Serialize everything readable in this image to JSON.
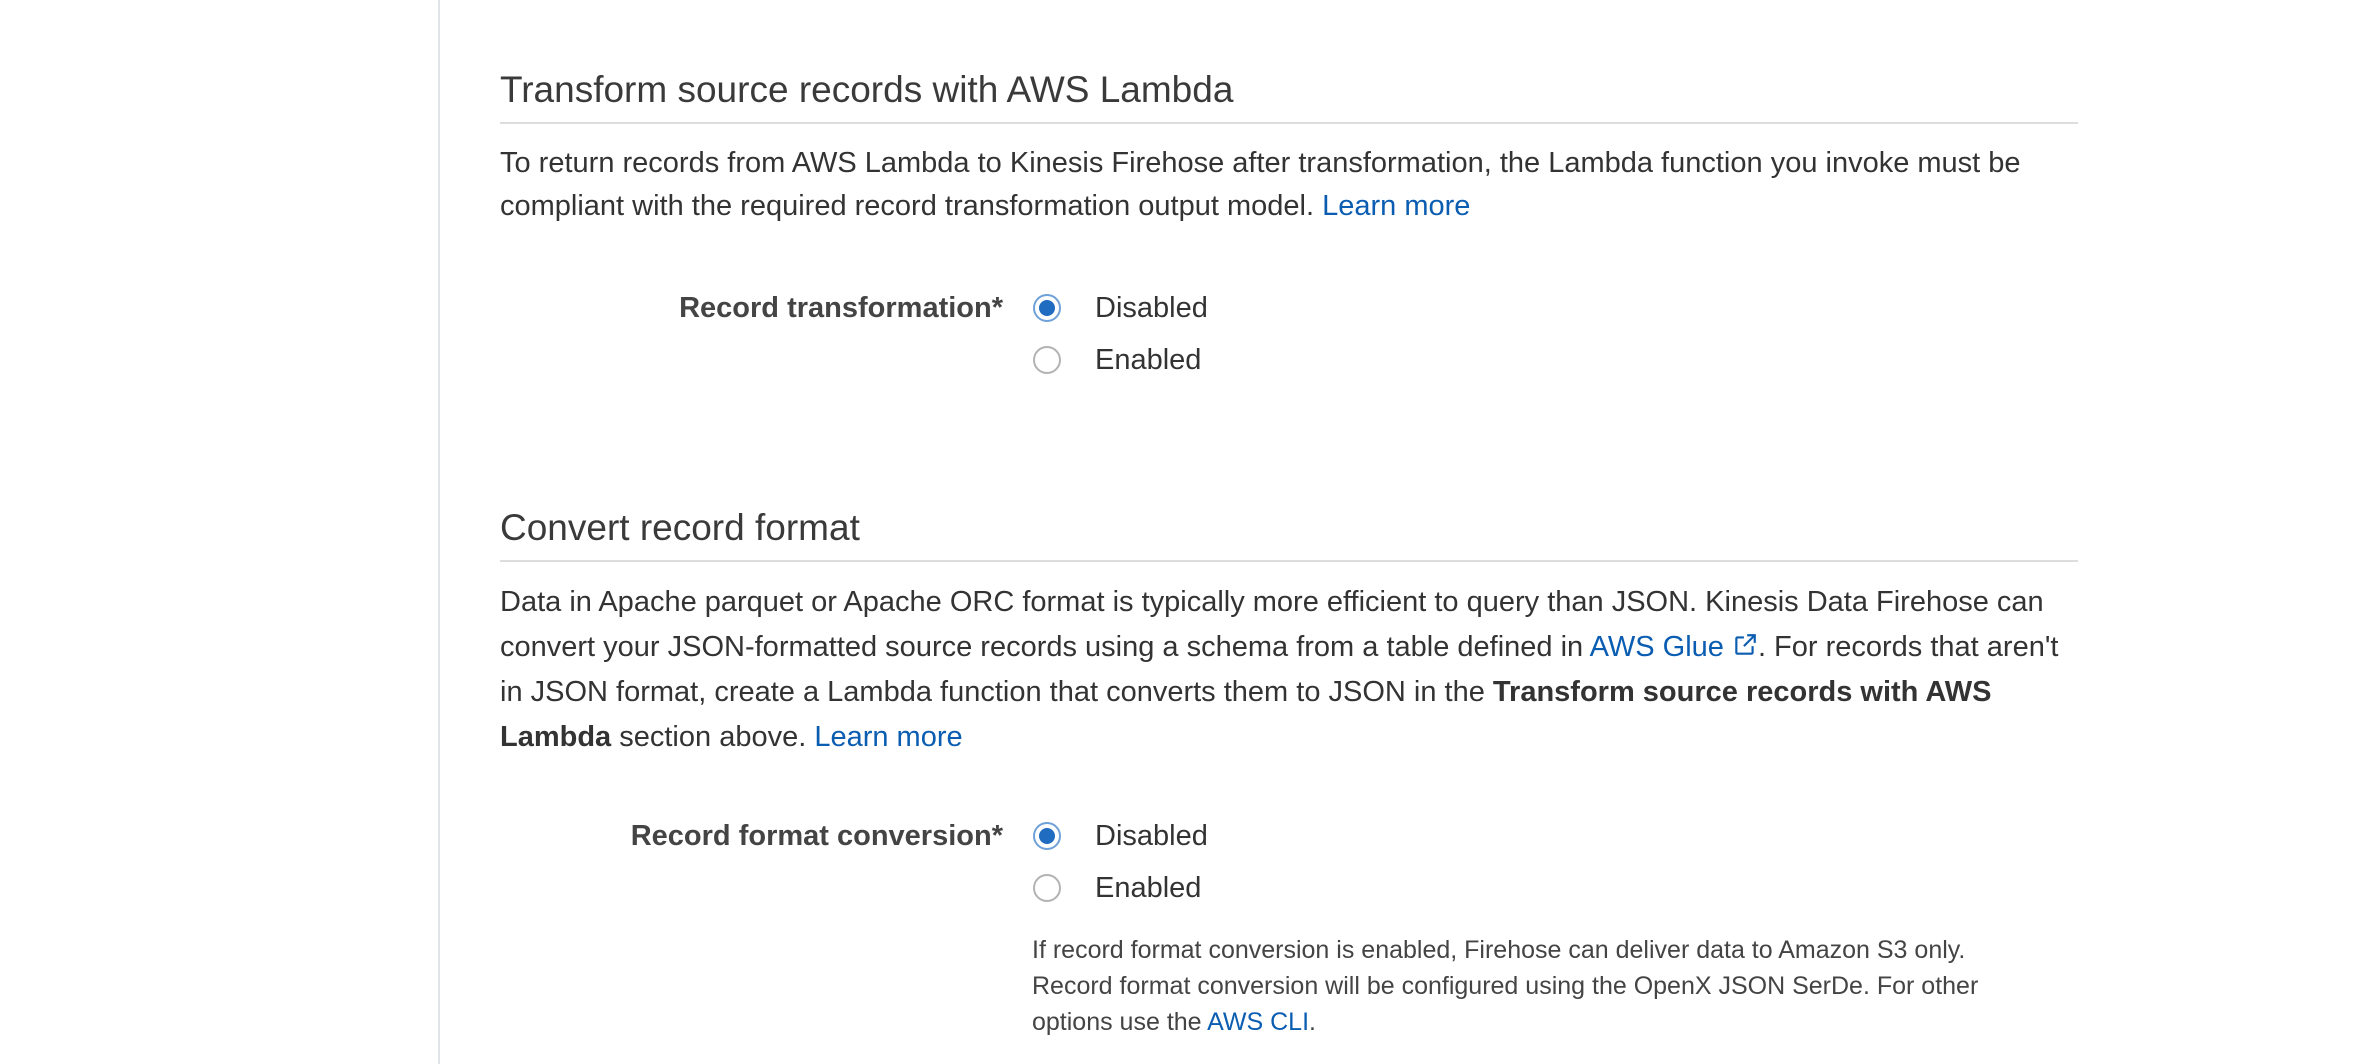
{
  "section_lambda": {
    "title": "Transform source records with AWS Lambda",
    "description": "To return records from AWS Lambda to Kinesis Firehose after transformation, the Lambda function you invoke must be compliant with the required record transformation output model.",
    "learn_more": "Learn more",
    "field_label": "Record transformation*",
    "options": [
      {
        "label": "Disabled",
        "checked": true
      },
      {
        "label": "Enabled",
        "checked": false
      }
    ]
  },
  "section_convert": {
    "title": "Convert record format",
    "description_part1": "Data in Apache parquet or Apache ORC format is typically more efficient to query than JSON. Kinesis Data Firehose can convert your JSON-formatted source records using a schema from a table defined in",
    "glue_link": "AWS Glue",
    "description_part2": ". For records that aren't in JSON format, create a Lambda function that converts them to JSON in the",
    "description_bold": "Transform source records with AWS Lambda",
    "description_part3": "section above.",
    "learn_more": "Learn more",
    "field_label": "Record format conversion*",
    "options": [
      {
        "label": "Disabled",
        "checked": true
      },
      {
        "label": "Enabled",
        "checked": false
      }
    ],
    "help_text": "If record format conversion is enabled, Firehose can deliver data to Amazon S3 only. Record format conversion will be configured using the OpenX JSON SerDe. For other options use the",
    "help_link": "AWS CLI",
    "help_end": "."
  },
  "colors": {
    "link": "#0b5db1",
    "radio_selected": "#1f6cc1",
    "divider": "#dddddd"
  },
  "icons": {
    "external_link": "external-link-icon"
  }
}
